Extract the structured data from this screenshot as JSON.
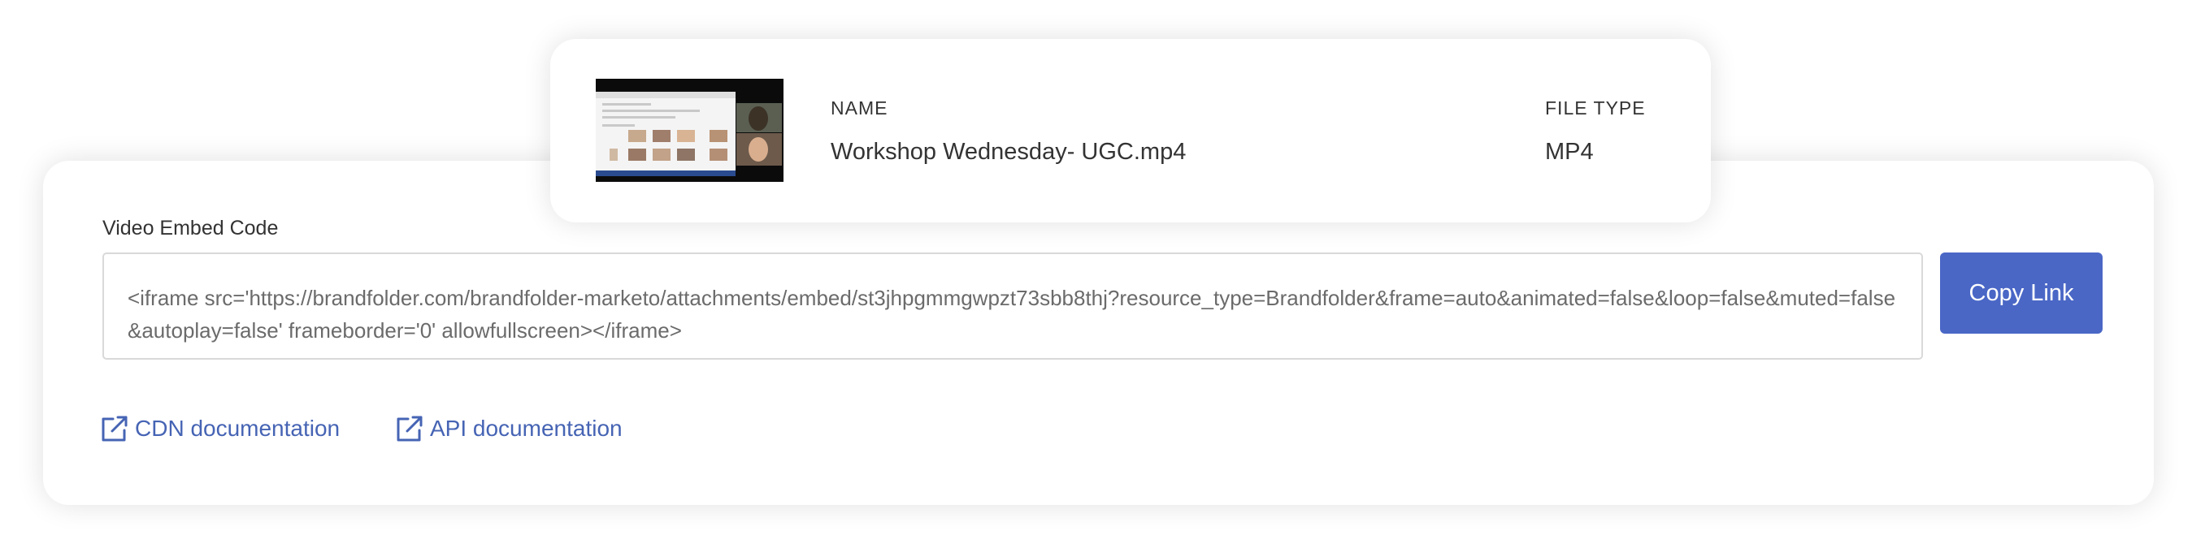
{
  "asset": {
    "name_label": "NAME",
    "name_value": "Workshop Wednesday- UGC.mp4",
    "type_label": "FILE TYPE",
    "type_value": "MP4"
  },
  "embed": {
    "label": "Video Embed Code",
    "code": "<iframe src='https://brandfolder.com/brandfolder-marketo/attachments/embed/st3jhpgmmgwpzt73sbb8thj?resource_type=Brandfolder&frame=auto&animated=false&loop=false&muted=false&autoplay=false' frameborder='0' allowfullscreen></iframe>",
    "copy_button": "Copy Link"
  },
  "links": {
    "cdn": "CDN documentation",
    "api": "API documentation"
  },
  "icons": {
    "doc_link_icon": "external-link-icon"
  },
  "colors": {
    "accent": "#4a67c6",
    "link": "#4664b4",
    "text": "#333333"
  }
}
